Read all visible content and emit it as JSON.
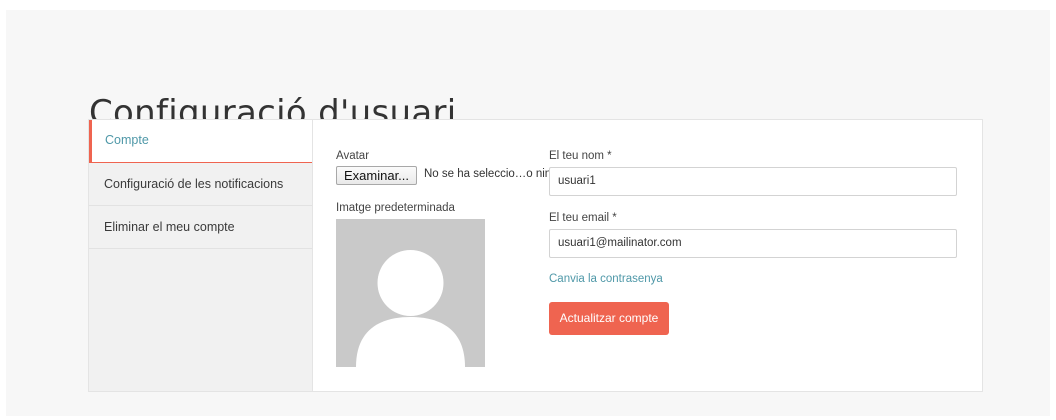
{
  "page": {
    "title": "Configuració d'usuari"
  },
  "sidebar": {
    "items": [
      {
        "label": "Compte"
      },
      {
        "label": "Configuració de les notificacions"
      },
      {
        "label": "Eliminar el meu compte"
      }
    ]
  },
  "avatar": {
    "label": "Avatar",
    "browse_label": "Examinar...",
    "file_status": "No se ha seleccio…o ningún archivo.",
    "default_image_label": "Imatge predeterminada"
  },
  "form": {
    "name_label": "El teu nom *",
    "name_value": "usuari1",
    "email_label": "El teu email *",
    "email_value": "usuari1@mailinator.com",
    "change_password_label": "Canvia la contrasenya",
    "submit_label": "Actualitzar compte"
  },
  "colors": {
    "accent": "#ef6450",
    "link": "#4f98a8",
    "placeholder_avatar": "#c9c9c9"
  },
  "icons": {
    "avatar": "user-silhouette-icon"
  }
}
